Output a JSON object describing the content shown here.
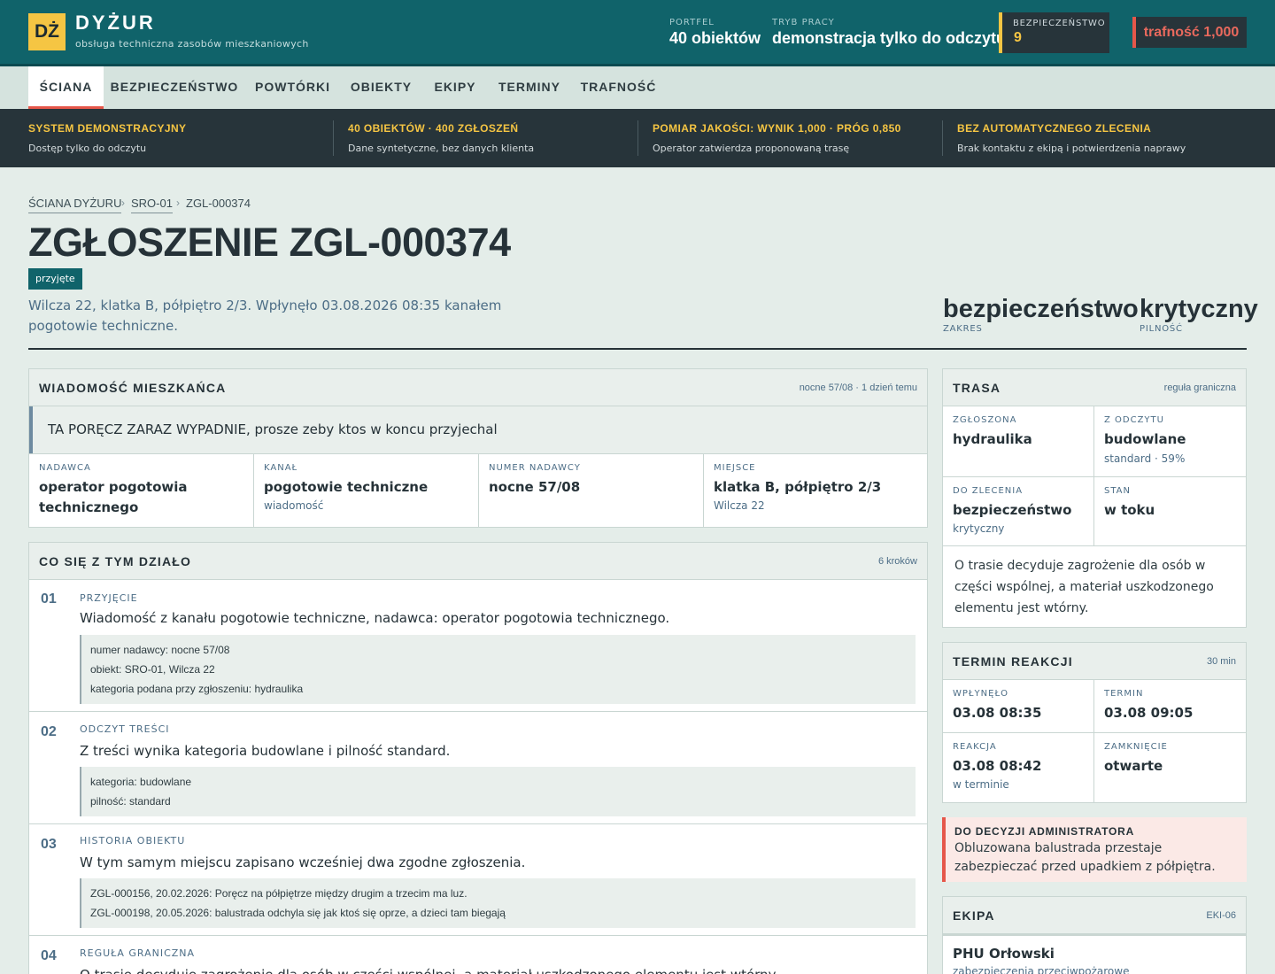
{
  "header": {
    "logo": "DŻ",
    "brand": "DYŻUR",
    "brand_sub": "obsługa techniczna zasobów mieszkaniowych",
    "portfolio_label": "PORTFEL",
    "portfolio_value": "40 obiektów",
    "mode_label": "TRYB PRACY",
    "mode_value": "demonstracja tylko do odczytu",
    "safety_label": "BEZPIECZEŃSTWO",
    "safety_value": "9",
    "accuracy": "trafność 1,000"
  },
  "nav": {
    "tabs": [
      "ŚCIANA",
      "BEZPIECZEŃSTWO",
      "POWTÓRKI",
      "OBIEKTY",
      "EKIPY",
      "TERMINY",
      "TRAFNOŚĆ"
    ],
    "active": "ŚCIANA"
  },
  "infobar": [
    {
      "title": "SYSTEM DEMONSTRACYJNY",
      "sub": "Dostęp tylko do odczytu"
    },
    {
      "title": "40 OBIEKTÓW · 400 ZGŁOSZEŃ",
      "sub": "Dane syntetyczne, bez danych klienta"
    },
    {
      "title": "POMIAR JAKOŚCI: WYNIK 1,000 · PRÓG 0,850",
      "sub": "Operator zatwierdza proponowaną trasę"
    },
    {
      "title": "BEZ AUTOMATYCZNEGO ZLECENIA",
      "sub": "Brak kontaktu z ekipą i potwierdzenia naprawy"
    }
  ],
  "breadcrumb": [
    "ŚCIANA DYŻURU",
    "SRO-01",
    "ZGL-000374"
  ],
  "ticket": {
    "title": "ZGŁOSZENIE ZGL-000374",
    "status": "przyjęte",
    "lead": "Wilcza 22, klatka B, półpiętro 2/3. Wpłynęło 03.08.2026 08:35 kanałem pogotowie techniczne.",
    "scope_value": "bezpieczeństwo",
    "scope_label": "ZAKRES",
    "priority_value": "krytyczny",
    "priority_label": "PILNOŚĆ"
  },
  "message_panel": {
    "title": "WIADOMOŚĆ MIESZKAŃCA",
    "meta": "nocne 57/08 · 1 dzień temu",
    "message": "TA PORĘCZ ZARAZ WYPADNIE, prosze zeby ktos w koncu przyjechal",
    "fields": [
      {
        "label": "NADAWCA",
        "value": "operator pogotowia technicznego",
        "sub": ""
      },
      {
        "label": "KANAŁ",
        "value": "pogotowie techniczne",
        "sub": "wiadomość"
      },
      {
        "label": "NUMER NADAWCY",
        "value": "nocne 57/08",
        "sub": ""
      },
      {
        "label": "MIEJSCE",
        "value": "klatka B, półpiętro 2/3",
        "sub": "Wilcza 22"
      }
    ]
  },
  "history_panel": {
    "title": "CO SIĘ Z TYM DZIAŁO",
    "meta": "6 kroków",
    "steps": [
      {
        "num": "01",
        "label": "PRZYJĘCIE",
        "desc": "Wiadomość z kanału pogotowie techniczne, nadawca: operator pogotowia technicznego.",
        "details": [
          "numer nadawcy: nocne 57/08",
          "obiekt: SRO-01, Wilcza 22",
          "kategoria podana przy zgłoszeniu: hydraulika"
        ]
      },
      {
        "num": "02",
        "label": "ODCZYT TREŚCI",
        "desc": "Z treści wynika kategoria budowlane i pilność standard.",
        "details": [
          "kategoria: budowlane",
          "pilność: standard"
        ]
      },
      {
        "num": "03",
        "label": "HISTORIA OBIEKTU",
        "desc": "W tym samym miejscu zapisano wcześniej dwa zgodne zgłoszenia.",
        "details": [
          "ZGL-000156, 20.02.2026: Poręcz na półpiętrze między drugim a trzecim ma luz.",
          "ZGL-000198, 20.05.2026: balustrada odchyla się jak ktoś się oprze, a dzieci tam biegają"
        ]
      },
      {
        "num": "04",
        "label": "REGUŁA GRANICZNA",
        "desc": "O trasie decyduje zagrożenie dla osób w części wspólnej, a materiał uszkodzonego elementu jest wtórny.",
        "details": []
      }
    ]
  },
  "route_panel": {
    "title": "TRASA",
    "meta": "reguła graniczna",
    "cells": [
      {
        "label": "ZGŁOSZONA",
        "value": "hydraulika",
        "sub": ""
      },
      {
        "label": "Z ODCZYTU",
        "value": "budowlane",
        "sub": "standard · 59%"
      },
      {
        "label": "DO ZLECENIA",
        "value": "bezpieczeństwo",
        "sub": "krytyczny"
      },
      {
        "label": "STAN",
        "value": "w toku",
        "sub": ""
      }
    ],
    "text": "O trasie decyduje zagrożenie dla osób w części wspólnej, a materiał uszkodzonego elementu jest wtórny."
  },
  "deadline_panel": {
    "title": "TERMIN REAKCJI",
    "meta": "30 min",
    "cells": [
      {
        "label": "WPŁYNĘŁO",
        "value": "03.08 08:35",
        "sub": ""
      },
      {
        "label": "TERMIN",
        "value": "03.08 09:05",
        "sub": ""
      },
      {
        "label": "REAKCJA",
        "value": "03.08 08:42",
        "sub": "w terminie"
      },
      {
        "label": "ZAMKNIĘCIE",
        "value": "otwarte",
        "sub": ""
      }
    ]
  },
  "admin_alert": {
    "title": "DO DECYZJI ADMINISTRATORA",
    "text": "Obluzowana balustrada przestaje zabezpieczać przed upadkiem z półpiętra."
  },
  "crew_panel": {
    "title": "EKIPA",
    "meta": "EKI-06",
    "name": "PHU Orłowski",
    "specialty": "zabezpieczenia przeciwpożarowe"
  },
  "colors": {
    "teal": "#10636a",
    "yellow": "#f5c543",
    "red": "#e5574a",
    "dark": "#27343a"
  }
}
